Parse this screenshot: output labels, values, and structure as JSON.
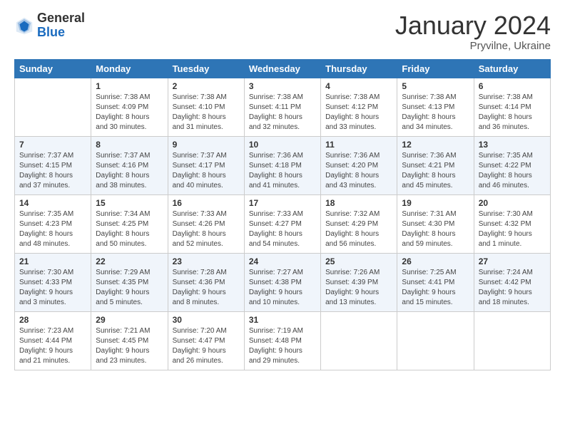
{
  "header": {
    "logo_general": "General",
    "logo_blue": "Blue",
    "title": "January 2024",
    "location": "Pryvilne, Ukraine"
  },
  "days_of_week": [
    "Sunday",
    "Monday",
    "Tuesday",
    "Wednesday",
    "Thursday",
    "Friday",
    "Saturday"
  ],
  "weeks": [
    [
      {
        "day": "",
        "content": ""
      },
      {
        "day": "1",
        "content": "Sunrise: 7:38 AM\nSunset: 4:09 PM\nDaylight: 8 hours\nand 30 minutes."
      },
      {
        "day": "2",
        "content": "Sunrise: 7:38 AM\nSunset: 4:10 PM\nDaylight: 8 hours\nand 31 minutes."
      },
      {
        "day": "3",
        "content": "Sunrise: 7:38 AM\nSunset: 4:11 PM\nDaylight: 8 hours\nand 32 minutes."
      },
      {
        "day": "4",
        "content": "Sunrise: 7:38 AM\nSunset: 4:12 PM\nDaylight: 8 hours\nand 33 minutes."
      },
      {
        "day": "5",
        "content": "Sunrise: 7:38 AM\nSunset: 4:13 PM\nDaylight: 8 hours\nand 34 minutes."
      },
      {
        "day": "6",
        "content": "Sunrise: 7:38 AM\nSunset: 4:14 PM\nDaylight: 8 hours\nand 36 minutes."
      }
    ],
    [
      {
        "day": "7",
        "content": "Sunrise: 7:37 AM\nSunset: 4:15 PM\nDaylight: 8 hours\nand 37 minutes."
      },
      {
        "day": "8",
        "content": "Sunrise: 7:37 AM\nSunset: 4:16 PM\nDaylight: 8 hours\nand 38 minutes."
      },
      {
        "day": "9",
        "content": "Sunrise: 7:37 AM\nSunset: 4:17 PM\nDaylight: 8 hours\nand 40 minutes."
      },
      {
        "day": "10",
        "content": "Sunrise: 7:36 AM\nSunset: 4:18 PM\nDaylight: 8 hours\nand 41 minutes."
      },
      {
        "day": "11",
        "content": "Sunrise: 7:36 AM\nSunset: 4:20 PM\nDaylight: 8 hours\nand 43 minutes."
      },
      {
        "day": "12",
        "content": "Sunrise: 7:36 AM\nSunset: 4:21 PM\nDaylight: 8 hours\nand 45 minutes."
      },
      {
        "day": "13",
        "content": "Sunrise: 7:35 AM\nSunset: 4:22 PM\nDaylight: 8 hours\nand 46 minutes."
      }
    ],
    [
      {
        "day": "14",
        "content": "Sunrise: 7:35 AM\nSunset: 4:23 PM\nDaylight: 8 hours\nand 48 minutes."
      },
      {
        "day": "15",
        "content": "Sunrise: 7:34 AM\nSunset: 4:25 PM\nDaylight: 8 hours\nand 50 minutes."
      },
      {
        "day": "16",
        "content": "Sunrise: 7:33 AM\nSunset: 4:26 PM\nDaylight: 8 hours\nand 52 minutes."
      },
      {
        "day": "17",
        "content": "Sunrise: 7:33 AM\nSunset: 4:27 PM\nDaylight: 8 hours\nand 54 minutes."
      },
      {
        "day": "18",
        "content": "Sunrise: 7:32 AM\nSunset: 4:29 PM\nDaylight: 8 hours\nand 56 minutes."
      },
      {
        "day": "19",
        "content": "Sunrise: 7:31 AM\nSunset: 4:30 PM\nDaylight: 8 hours\nand 59 minutes."
      },
      {
        "day": "20",
        "content": "Sunrise: 7:30 AM\nSunset: 4:32 PM\nDaylight: 9 hours\nand 1 minute."
      }
    ],
    [
      {
        "day": "21",
        "content": "Sunrise: 7:30 AM\nSunset: 4:33 PM\nDaylight: 9 hours\nand 3 minutes."
      },
      {
        "day": "22",
        "content": "Sunrise: 7:29 AM\nSunset: 4:35 PM\nDaylight: 9 hours\nand 5 minutes."
      },
      {
        "day": "23",
        "content": "Sunrise: 7:28 AM\nSunset: 4:36 PM\nDaylight: 9 hours\nand 8 minutes."
      },
      {
        "day": "24",
        "content": "Sunrise: 7:27 AM\nSunset: 4:38 PM\nDaylight: 9 hours\nand 10 minutes."
      },
      {
        "day": "25",
        "content": "Sunrise: 7:26 AM\nSunset: 4:39 PM\nDaylight: 9 hours\nand 13 minutes."
      },
      {
        "day": "26",
        "content": "Sunrise: 7:25 AM\nSunset: 4:41 PM\nDaylight: 9 hours\nand 15 minutes."
      },
      {
        "day": "27",
        "content": "Sunrise: 7:24 AM\nSunset: 4:42 PM\nDaylight: 9 hours\nand 18 minutes."
      }
    ],
    [
      {
        "day": "28",
        "content": "Sunrise: 7:23 AM\nSunset: 4:44 PM\nDaylight: 9 hours\nand 21 minutes."
      },
      {
        "day": "29",
        "content": "Sunrise: 7:21 AM\nSunset: 4:45 PM\nDaylight: 9 hours\nand 23 minutes."
      },
      {
        "day": "30",
        "content": "Sunrise: 7:20 AM\nSunset: 4:47 PM\nDaylight: 9 hours\nand 26 minutes."
      },
      {
        "day": "31",
        "content": "Sunrise: 7:19 AM\nSunset: 4:48 PM\nDaylight: 9 hours\nand 29 minutes."
      },
      {
        "day": "",
        "content": ""
      },
      {
        "day": "",
        "content": ""
      },
      {
        "day": "",
        "content": ""
      }
    ]
  ]
}
